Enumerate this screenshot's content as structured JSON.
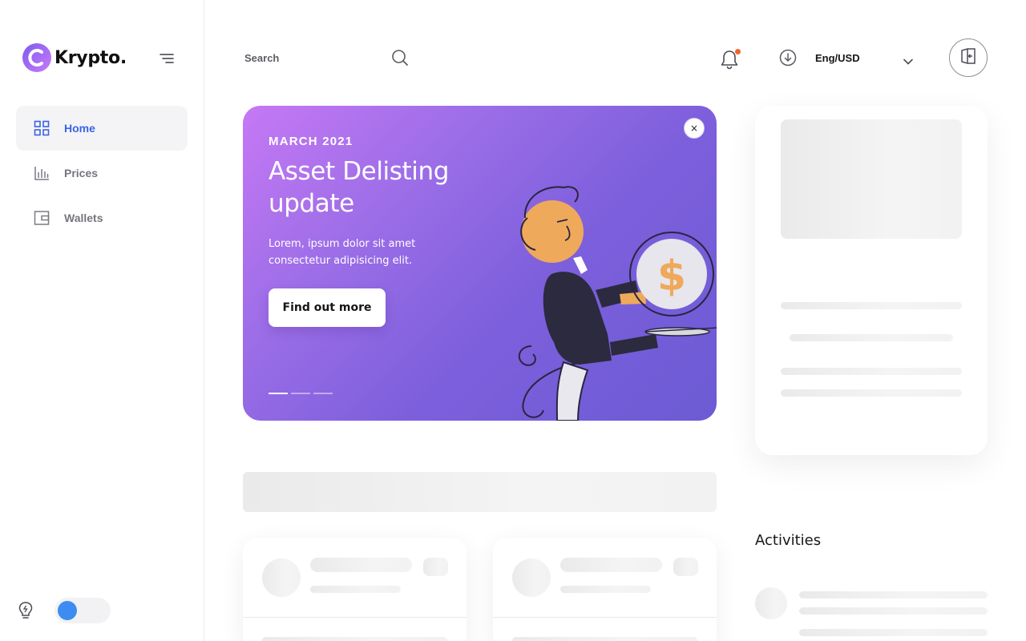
{
  "brand": {
    "name": "Krypto."
  },
  "sidebar": {
    "items": [
      {
        "label": "Home",
        "icon": "grid-icon",
        "active": true
      },
      {
        "label": "Prices",
        "icon": "bar-chart-icon",
        "active": false
      },
      {
        "label": "Wallets",
        "icon": "wallet-icon",
        "active": false
      }
    ],
    "theme_toggle": {
      "icon": "lightbulb-icon",
      "state": "off"
    }
  },
  "header": {
    "search": {
      "placeholder": "Search",
      "value": ""
    },
    "notifications": {
      "icon": "bell-icon",
      "has_unread": true
    },
    "language": {
      "label": "Eng/USD",
      "icon": "download-circle-icon"
    },
    "logout": {
      "icon": "logout-icon"
    }
  },
  "banner": {
    "date": "MARCH 2021",
    "title": "Asset Delisting update",
    "text": "Lorem, ipsum dolor sit amet consectetur adipisicing elit.",
    "button_label": "Find out more",
    "close_label": "×",
    "slides": 3,
    "active_slide": 1
  },
  "activities": {
    "title": "Activities"
  },
  "colors": {
    "accent": "#3a63e6",
    "banner_start": "#c678f4",
    "banner_end": "#6c5bd4",
    "notification_dot": "#f1642f",
    "toggle_knob": "#3e8bf2"
  }
}
